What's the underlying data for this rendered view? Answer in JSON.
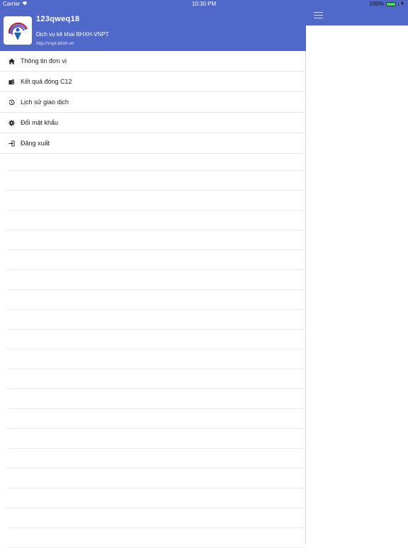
{
  "status_bar": {
    "carrier": "Carrier",
    "time": "10:30 PM",
    "battery_label": "100%",
    "battery_level": 1.0,
    "wifi_icon": "wifi-icon",
    "battery_icon": "battery-icon",
    "charging_icon": "charging-icon"
  },
  "drawer": {
    "header": {
      "username": "123qweq18",
      "service": "Dịch vụ kê khai BHXH-VNPT",
      "website": "http://vnpt-bhxh.vn",
      "logo_icon": "vnpt-bhxh-logo",
      "background_color": "#4f68c9"
    },
    "menu": [
      {
        "label": "Thông tin đơn vị",
        "icon": "home-icon"
      },
      {
        "label": "Kết quả đóng C12",
        "icon": "wallet-icon"
      },
      {
        "label": "Lịch sử giao dịch",
        "icon": "history-icon"
      },
      {
        "label": "Đổi mật khẩu",
        "icon": "gear-icon"
      },
      {
        "label": "Đăng xuất",
        "icon": "logout-icon"
      }
    ]
  },
  "content": {
    "menu_icon": "hamburger-icon"
  }
}
